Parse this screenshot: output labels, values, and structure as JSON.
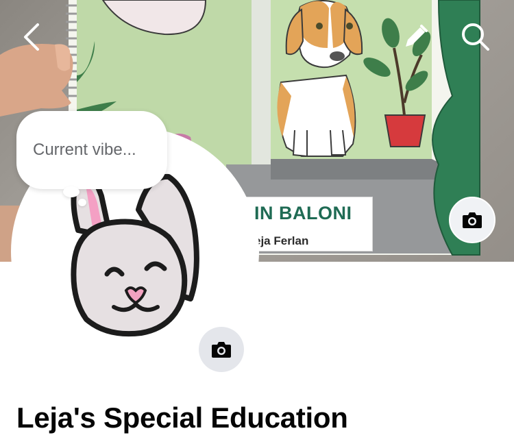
{
  "cover": {
    "book_title": "IN BALONI",
    "book_author": "eja Ferlan"
  },
  "header": {
    "back_icon": "chevron-left-icon",
    "edit_icon": "pencil-icon",
    "search_icon": "search-icon"
  },
  "status_bubble": {
    "placeholder": "Current vibe..."
  },
  "profile": {
    "name": "Leja's Special Education"
  },
  "icons": {
    "cover_camera": "camera-icon",
    "avatar_camera": "camera-icon"
  },
  "colors": {
    "title_green": "#1f6b54",
    "name_text": "#050505",
    "placeholder_text": "#65676b",
    "camera_button_bg": "#e4e6eb"
  }
}
